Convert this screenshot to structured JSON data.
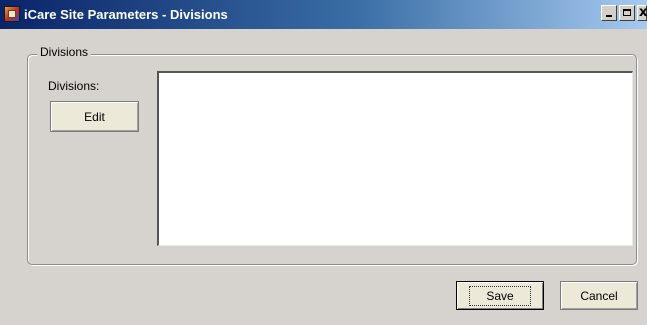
{
  "window": {
    "title": "iCare Site Parameters - Divisions",
    "icon": "app-icon",
    "title_buttons": [
      "minimize-icon",
      "maximize-icon",
      "close-icon"
    ]
  },
  "group": {
    "legend": "Divisions",
    "field_label": "Divisions:",
    "edit_label": "Edit",
    "list_items": []
  },
  "footer": {
    "save_label": "Save",
    "cancel_label": "Cancel"
  },
  "colors": {
    "titlebar_start": "#0a246a",
    "titlebar_end": "#a6caf0",
    "face": "#d6d3ce"
  }
}
